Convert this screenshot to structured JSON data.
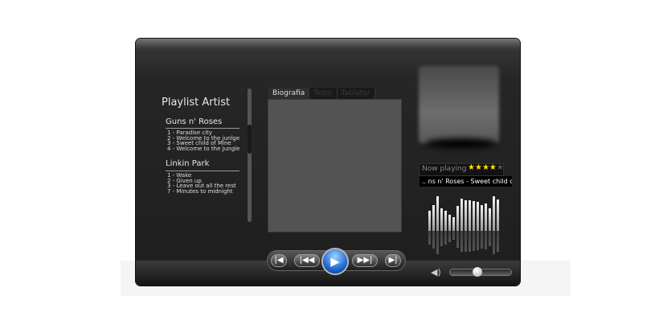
{
  "playlist": {
    "title": "Playlist Artist",
    "artists": [
      {
        "name": "Guns n' Roses",
        "tracks": [
          "1 - Paradise city",
          "2 - Welcome to the junlge",
          "3 - Sweet child of Mine",
          "4 - Welcome to the Jungle"
        ]
      },
      {
        "name": "Linkin Park",
        "tracks": [
          "1 - Wake",
          "2 - Given up",
          "3 - Leave out all the rest",
          "7 -  Minutes to midnight"
        ]
      }
    ]
  },
  "tabs": [
    {
      "label": "Biografia",
      "active": true
    },
    {
      "label": "Testo",
      "active": false
    },
    {
      "label": "Tablatur",
      "active": false
    }
  ],
  "now_playing": {
    "label": "Now playing",
    "rating": 4,
    "rating_max": 5,
    "song": ".. ns n' Roses - Sweet child of .."
  },
  "equalizer": {
    "levels": [
      0.55,
      0.72,
      0.95,
      0.62,
      0.55,
      0.45,
      0.38,
      0.7,
      0.88,
      0.85,
      0.85,
      0.82,
      0.8,
      0.72,
      0.75,
      0.62,
      0.95,
      0.86
    ]
  },
  "controls": {
    "prev_track": "|◀",
    "rewind": "|◀◀",
    "play": "▶",
    "forward": "▶▶|",
    "next_track": "▶|"
  },
  "volume": {
    "icon": "speaker-icon",
    "level": 0.45
  },
  "colors": {
    "star_on": "#ffe100",
    "star_off": "#555555",
    "play_button": "#1f6ad6"
  }
}
